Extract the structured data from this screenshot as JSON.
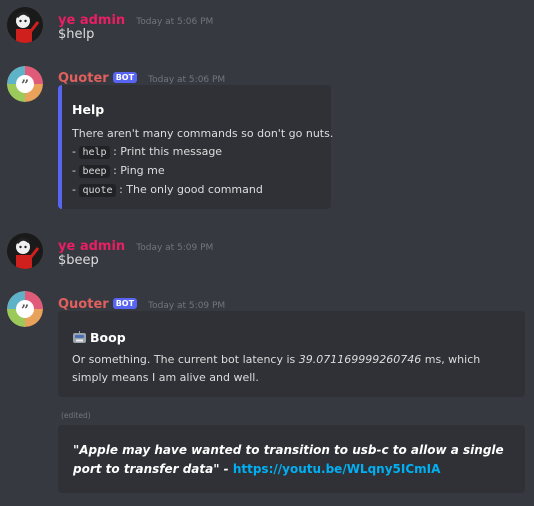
{
  "messages": [
    {
      "author": "ye admin",
      "timestamp": "Today at 5:06 PM",
      "text": "$help"
    },
    {
      "author": "Quoter",
      "badge": "BOT",
      "timestamp": "Today at 5:06 PM",
      "embed": {
        "title": "Help",
        "intro": "There aren't many commands so don't go nuts.",
        "commands": [
          {
            "prefix": "- ",
            "name": "help",
            "desc": ": Print this message"
          },
          {
            "prefix": "- ",
            "name": "beep",
            "desc": ": Ping me"
          },
          {
            "prefix": "- ",
            "name": "quote",
            "desc": ": The only good command"
          }
        ]
      }
    },
    {
      "author": "ye admin",
      "timestamp": "Today at 5:09 PM",
      "text": "$beep"
    },
    {
      "author": "Quoter",
      "badge": "BOT",
      "timestamp": "Today at 5:09 PM",
      "embed": {
        "title_emoji": "robot-emoji",
        "title": "Boop",
        "desc_prefix": "Or something. The current bot latency is ",
        "latency": "39.071169999260746",
        "desc_suffix": " ms, which simply means I am alive and well."
      },
      "edited_label": "(edited)",
      "quote_embed": {
        "quote": "\"Apple may have wanted to transition to usb-c to allow a single port to transfer data\" - ",
        "link": "https://youtu.be/WLqny5ICmIA"
      }
    }
  ],
  "colors": {
    "background": "#36393f",
    "embed": "#2f3136",
    "admin_name": "#e91e63",
    "bot_name": "#e0605e",
    "accent": "#5865f2",
    "link": "#00b0f4"
  }
}
